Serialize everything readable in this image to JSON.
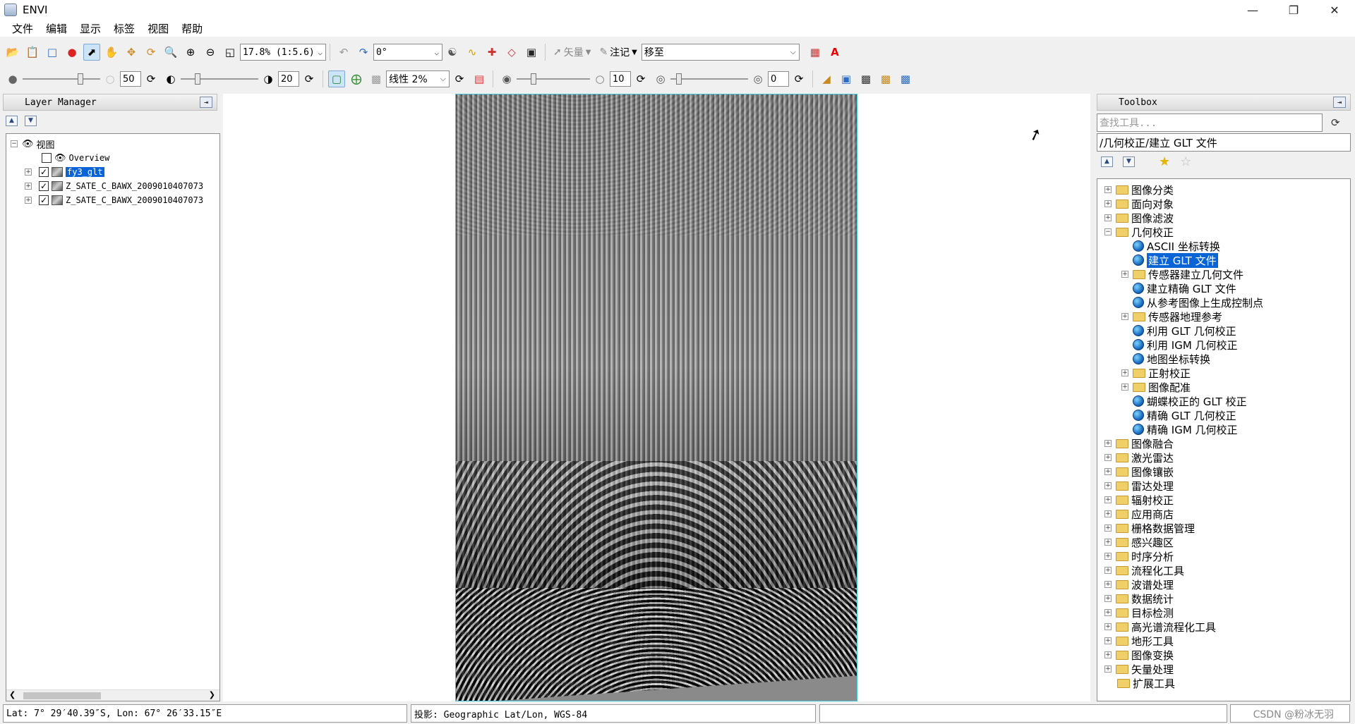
{
  "window": {
    "title": "ENVI"
  },
  "menu": [
    "文件",
    "编辑",
    "显示",
    "标签",
    "视图",
    "帮助"
  ],
  "toolbar1": {
    "zoom_value": "17.8% (1:5.6)",
    "rotation_value": "0°",
    "vector_label": "矢量",
    "annotation_label": "注记",
    "goto_value": "移至"
  },
  "toolbar2": {
    "brightness_value": "50",
    "contrast_value": "20",
    "stretch_value": "线性 2%",
    "sharpen_value": "10",
    "transparency_value": "0"
  },
  "layer_manager": {
    "title": "Layer Manager",
    "root_label": "视图",
    "items": [
      {
        "label": "Overview",
        "checked": false
      },
      {
        "label": "fy3_glt",
        "checked": true,
        "selected": true
      },
      {
        "label": "Z_SATE_C_BAWX_2009010407073",
        "checked": true
      },
      {
        "label": "Z_SATE_C_BAWX_2009010407073",
        "checked": true
      }
    ]
  },
  "toolbox": {
    "title": "Toolbox",
    "search_placeholder": "查找工具...",
    "path": "/几何校正/建立 GLT 文件",
    "top_folders_before": [
      "图像分类",
      "面向对象",
      "图像滤波"
    ],
    "expanded_folder": "几何校正",
    "children": [
      {
        "label": "ASCII 坐标转换",
        "kind": "tool"
      },
      {
        "label": "建立 GLT 文件",
        "kind": "tool",
        "selected": true
      },
      {
        "label": "传感器建立几何文件",
        "kind": "folder"
      },
      {
        "label": "建立精确 GLT 文件",
        "kind": "tool"
      },
      {
        "label": "从参考图像上生成控制点",
        "kind": "tool"
      },
      {
        "label": "传感器地理参考",
        "kind": "folder"
      },
      {
        "label": "利用 GLT 几何校正",
        "kind": "tool"
      },
      {
        "label": "利用 IGM 几何校正",
        "kind": "tool"
      },
      {
        "label": "地图坐标转换",
        "kind": "tool"
      },
      {
        "label": "正射校正",
        "kind": "folder"
      },
      {
        "label": "图像配准",
        "kind": "folder"
      },
      {
        "label": "蝴蝶校正的 GLT 校正",
        "kind": "tool"
      },
      {
        "label": "精确 GLT 几何校正",
        "kind": "tool"
      },
      {
        "label": "精确 IGM 几何校正",
        "kind": "tool"
      }
    ],
    "top_folders_after": [
      "图像融合",
      "激光雷达",
      "图像镶嵌",
      "雷达处理",
      "辐射校正",
      "应用商店",
      "栅格数据管理",
      "感兴趣区",
      "时序分析",
      "流程化工具",
      "波谱处理",
      "数据统计",
      "目标检测",
      "高光谱流程化工具",
      "地形工具",
      "图像变换",
      "矢量处理",
      "扩展工具"
    ]
  },
  "status": {
    "coords": "Lat: 7° 29′40.39″S, Lon: 67° 26′33.15″E",
    "projection": "投影: Geographic Lat/Lon, WGS-84",
    "empty": ""
  },
  "watermark": "CSDN @粉冰无羽"
}
